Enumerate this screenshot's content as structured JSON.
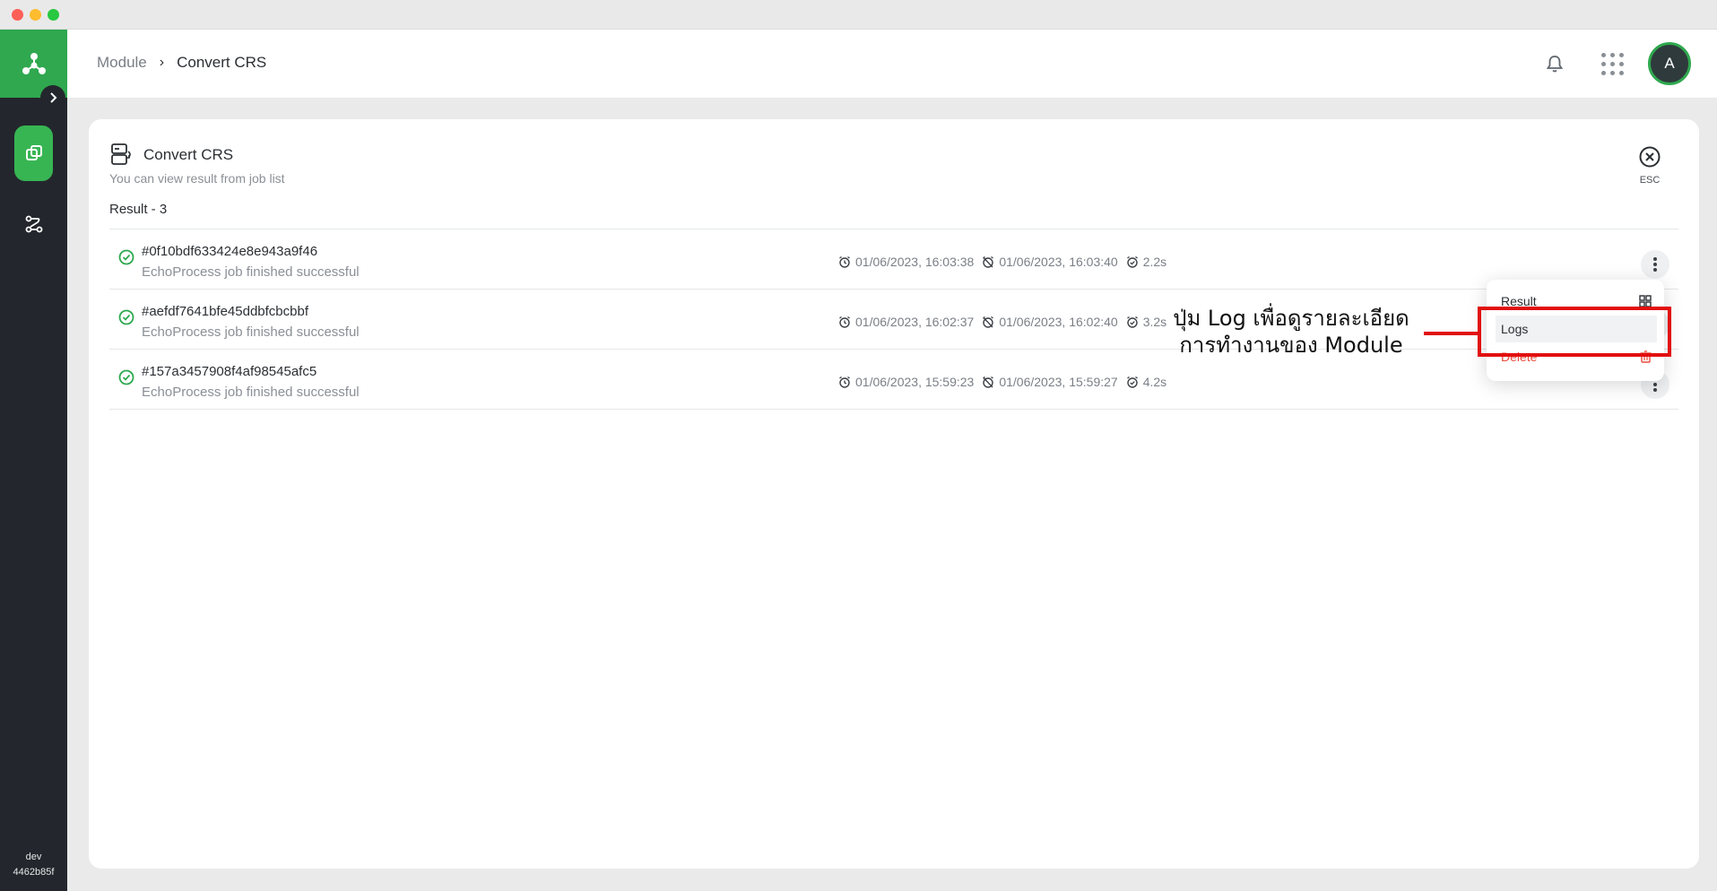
{
  "breadcrumb": {
    "parent": "Module",
    "separator": "›",
    "current": "Convert CRS"
  },
  "header": {
    "avatar_initial": "A"
  },
  "sidebar": {
    "env_name": "dev",
    "env_hash": "4462b85f"
  },
  "card": {
    "title": "Convert CRS",
    "subtitle": "You can view result from job list",
    "result_count": "Result - 3",
    "esc_label": "ESC"
  },
  "jobs": [
    {
      "id": "#0f10bdf633424e8e943a9f46",
      "message": "EchoProcess job finished successful",
      "start": "01/06/2023, 16:03:38",
      "end": "01/06/2023, 16:03:40",
      "duration": "2.2s"
    },
    {
      "id": "#aefdf7641bfe45ddbfcbcbbf",
      "message": "EchoProcess job finished successful",
      "start": "01/06/2023, 16:02:37",
      "end": "01/06/2023, 16:02:40",
      "duration": "3.2s"
    },
    {
      "id": "#157a3457908f4af98545afc5",
      "message": "EchoProcess job finished successful",
      "start": "01/06/2023, 15:59:23",
      "end": "01/06/2023, 15:59:27",
      "duration": "4.2s"
    }
  ],
  "menu": {
    "result": "Result",
    "logs": "Logs",
    "delete": "Delete"
  },
  "annotation": {
    "line1": "ปุ่ม Log เพื่อดูรายละเอียด",
    "line2": "การทำงานของ Module"
  },
  "colors": {
    "brand_green": "#2fa84f",
    "sidebar_dark": "#23272d",
    "annotation_red": "#e20f0f",
    "delete_red": "#e84b3c"
  }
}
